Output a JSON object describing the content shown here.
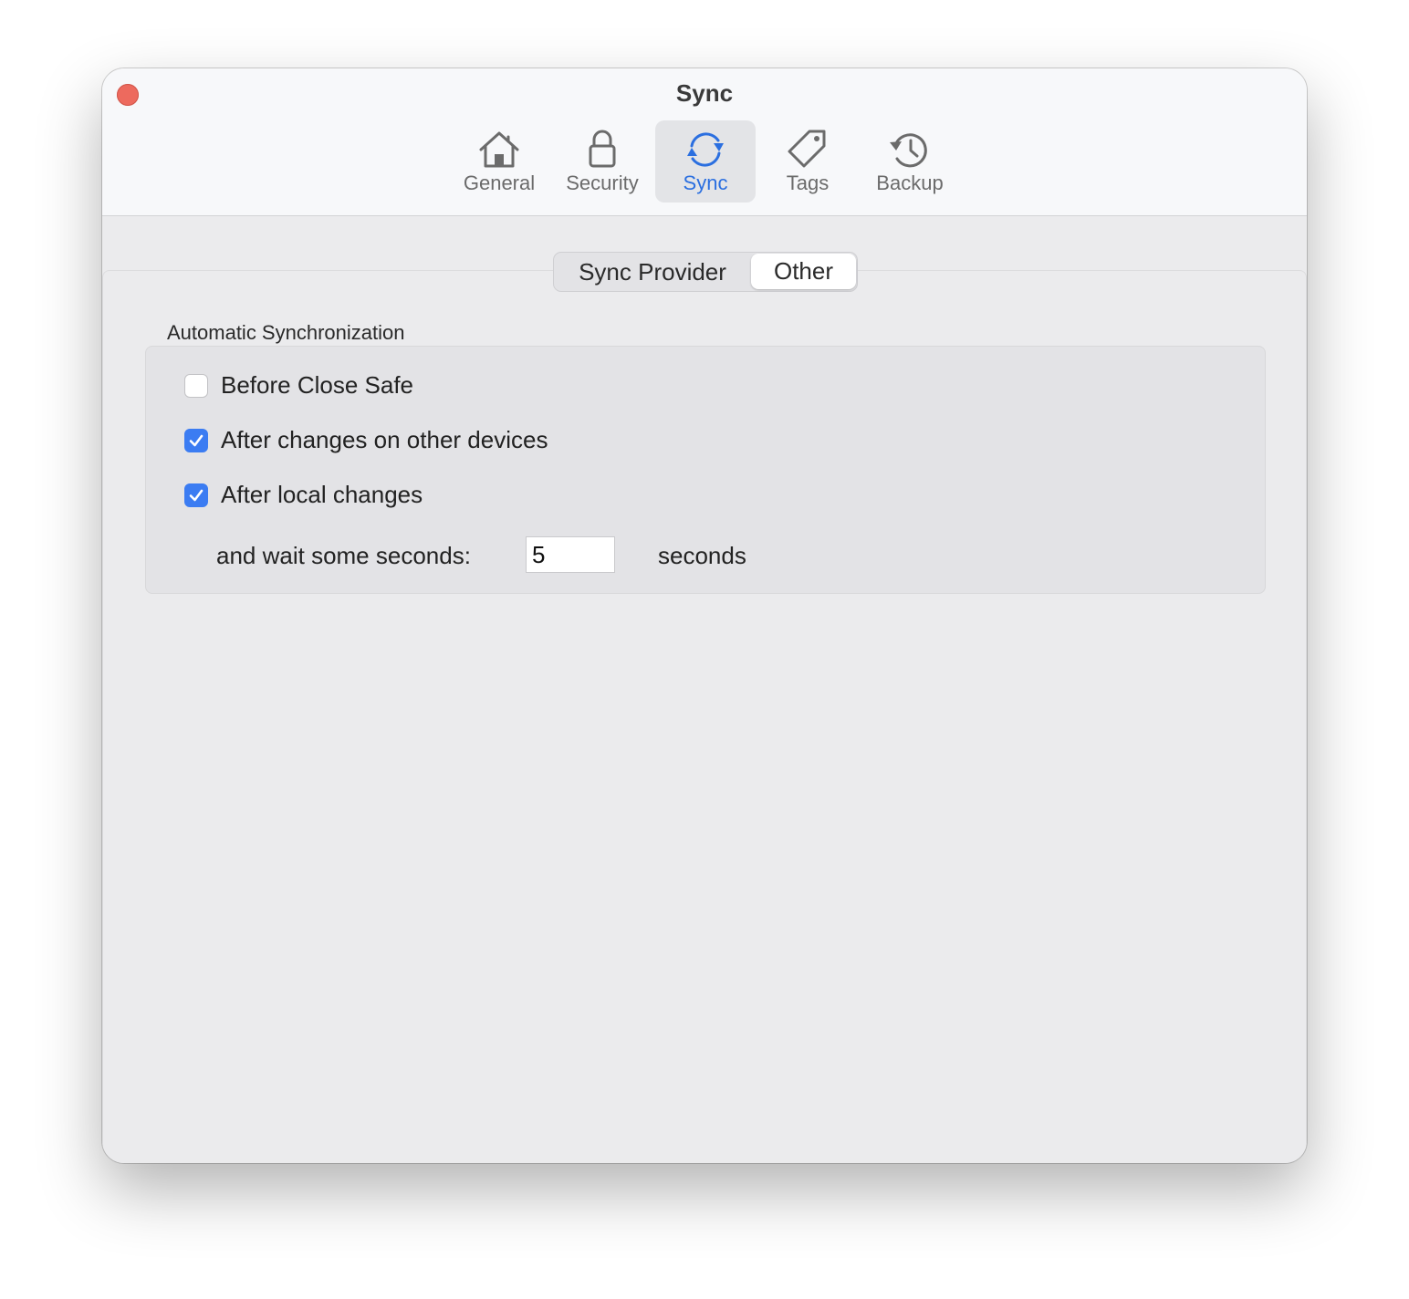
{
  "window": {
    "title": "Sync"
  },
  "toolbar": {
    "items": [
      {
        "label": "General",
        "icon": "house-icon",
        "selected": false
      },
      {
        "label": "Security",
        "icon": "lock-icon",
        "selected": false
      },
      {
        "label": "Sync",
        "icon": "sync-icon",
        "selected": true
      },
      {
        "label": "Tags",
        "icon": "tag-icon",
        "selected": false
      },
      {
        "label": "Backup",
        "icon": "history-icon",
        "selected": false
      }
    ]
  },
  "segmented": {
    "options": [
      "Sync Provider",
      "Other"
    ],
    "selected": "Other"
  },
  "auto_sync": {
    "title": "Automatic Synchronization",
    "options": [
      {
        "label": "Before Close Safe",
        "checked": false
      },
      {
        "label": "After changes on other devices",
        "checked": true
      },
      {
        "label": "After local changes",
        "checked": true
      }
    ],
    "wait_label": "and wait some seconds:",
    "wait_value": "5",
    "unit_label": "seconds"
  },
  "colors": {
    "accent": "#2b6fe0",
    "checkbox_on": "#3b7cf2",
    "close": "#ed6a5e"
  }
}
